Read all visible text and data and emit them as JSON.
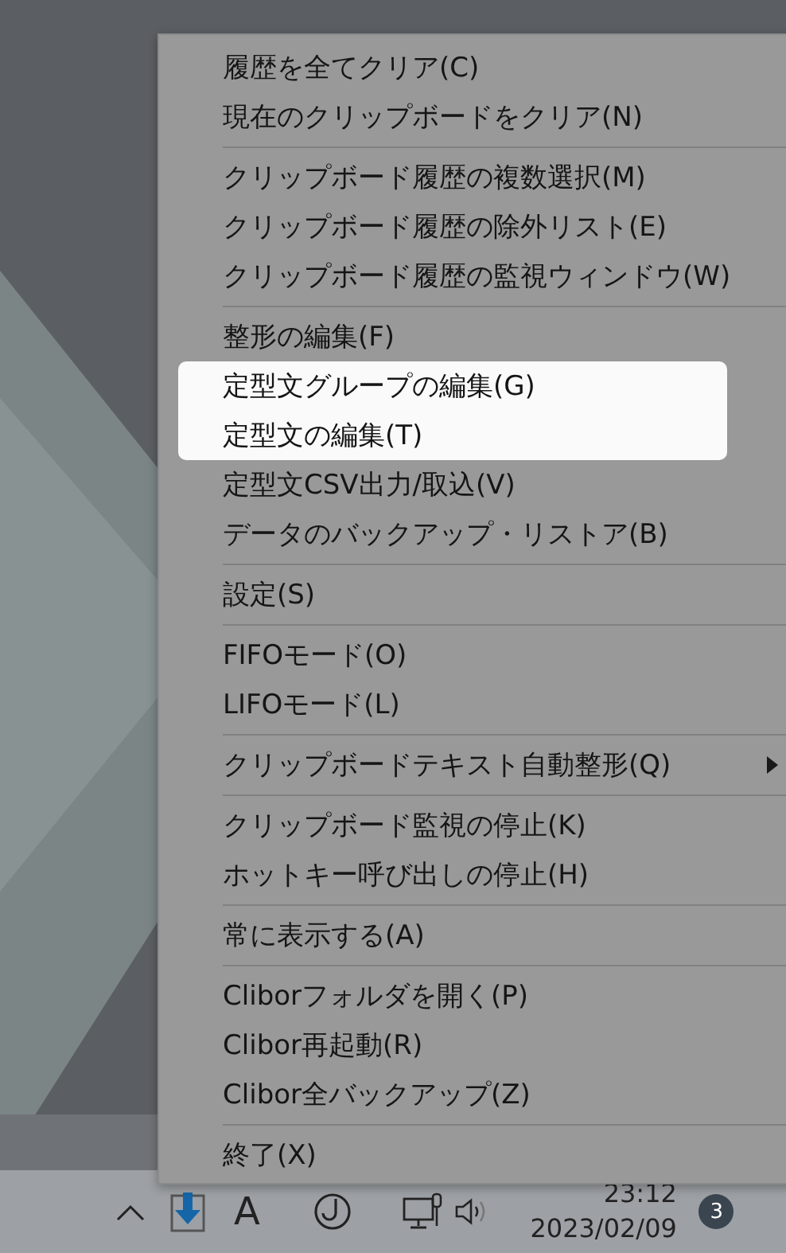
{
  "menu": {
    "groups": [
      {
        "items": [
          {
            "label": "履歴を全てクリア(C)",
            "highlighted": false
          },
          {
            "label": "現在のクリップボードをクリア(N)",
            "highlighted": false
          }
        ]
      },
      {
        "items": [
          {
            "label": "クリップボード履歴の複数選択(M)",
            "highlighted": false
          },
          {
            "label": "クリップボード履歴の除外リスト(E)",
            "highlighted": false
          },
          {
            "label": "クリップボード履歴の監視ウィンドウ(W)",
            "highlighted": false
          }
        ]
      },
      {
        "items": [
          {
            "label": "整形の編集(F)",
            "highlighted": false
          },
          {
            "label": "定型文グループの編集(G)",
            "highlighted": true
          },
          {
            "label": "定型文の編集(T)",
            "highlighted": true
          },
          {
            "label": "定型文CSV出力/取込(V)",
            "highlighted": false
          },
          {
            "label": "データのバックアップ・リストア(B)",
            "highlighted": false
          }
        ]
      },
      {
        "items": [
          {
            "label": "設定(S)",
            "highlighted": false
          }
        ]
      },
      {
        "items": [
          {
            "label": "FIFOモード(O)",
            "highlighted": false
          },
          {
            "label": "LIFOモード(L)",
            "highlighted": false
          }
        ]
      },
      {
        "items": [
          {
            "label": "クリップボードテキスト自動整形(Q)",
            "highlighted": false,
            "submenu": true
          }
        ]
      },
      {
        "items": [
          {
            "label": "クリップボード監視の停止(K)",
            "highlighted": false
          },
          {
            "label": "ホットキー呼び出しの停止(H)",
            "highlighted": false
          }
        ]
      },
      {
        "items": [
          {
            "label": "常に表示する(A)",
            "highlighted": false
          }
        ]
      },
      {
        "items": [
          {
            "label": "Cliborフォルダを開く(P)",
            "highlighted": false
          },
          {
            "label": "Clibor再起動(R)",
            "highlighted": false
          },
          {
            "label": "Clibor全バックアップ(Z)",
            "highlighted": false
          }
        ]
      },
      {
        "items": [
          {
            "label": "終了(X)",
            "highlighted": false
          }
        ]
      }
    ]
  },
  "taskbar": {
    "ime_mode": "A",
    "time": "23:12",
    "date": "2023/02/09",
    "notification_count": "3"
  }
}
